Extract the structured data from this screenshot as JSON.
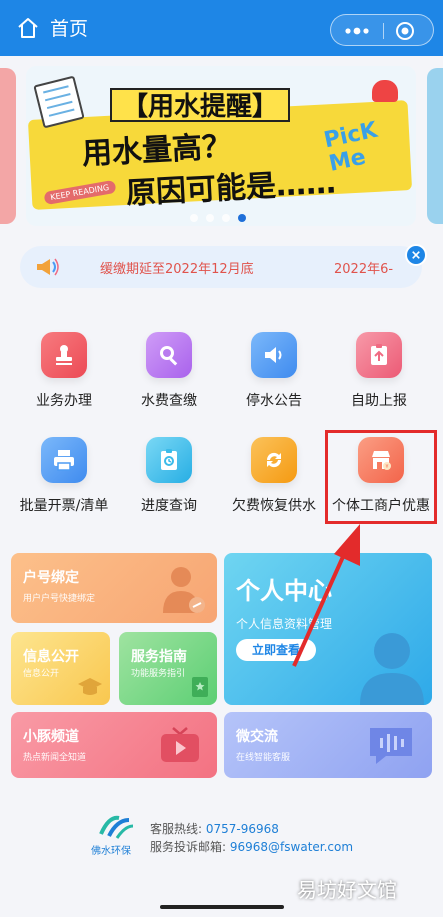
{
  "header": {
    "title": "首页"
  },
  "banner": {
    "title": "【用水提醒】",
    "line1": "用水量高？",
    "line2": "原因可能是……",
    "pick": "PicK Me",
    "keep": "KEEP READING"
  },
  "notice": {
    "text1": "缓缴期延至2022年12月底",
    "text2": "2022年6-"
  },
  "menu": [
    {
      "label": "业务办理",
      "color": "#f0565b",
      "icon": "stamp-icon"
    },
    {
      "label": "水费查缴",
      "color": "#b97bef",
      "icon": "magnifier-icon"
    },
    {
      "label": "停水公告",
      "color": "#4d9cf4",
      "icon": "speaker-icon"
    },
    {
      "label": "自助上报",
      "color": "#f06a82",
      "icon": "upload-icon"
    },
    {
      "label": "批量开票/清单",
      "color": "#4d9cf4",
      "icon": "printer-icon"
    },
    {
      "label": "进度查询",
      "color": "#3bbbe9",
      "icon": "clipboard-icon"
    },
    {
      "label": "欠费恢复供水",
      "color": "#f7a51c",
      "icon": "refresh-icon"
    },
    {
      "label": "个体工商户优惠",
      "color": "#f77b5f",
      "icon": "shop-icon"
    }
  ],
  "cards": {
    "bind": {
      "title": "户号绑定",
      "sub": "用户户号快捷绑定"
    },
    "personal": {
      "title": "个人中心",
      "sub": "个人信息资料管理",
      "button": "立即查看"
    },
    "info": {
      "title": "信息公开",
      "sub": "信息公开"
    },
    "guide": {
      "title": "服务指南",
      "sub": "功能服务指引"
    },
    "channel": {
      "title": "小豚频道",
      "sub": "热点新闻全知道"
    },
    "chat": {
      "title": "微交流",
      "sub": "在线智能客服"
    }
  },
  "footer": {
    "brand": "佛水环保",
    "hotline_label": "客服热线:",
    "hotline": "0757-96968",
    "email_label": "服务投诉邮箱:",
    "email": "96968@fswater.com"
  },
  "watermark": "易坊好文馆"
}
